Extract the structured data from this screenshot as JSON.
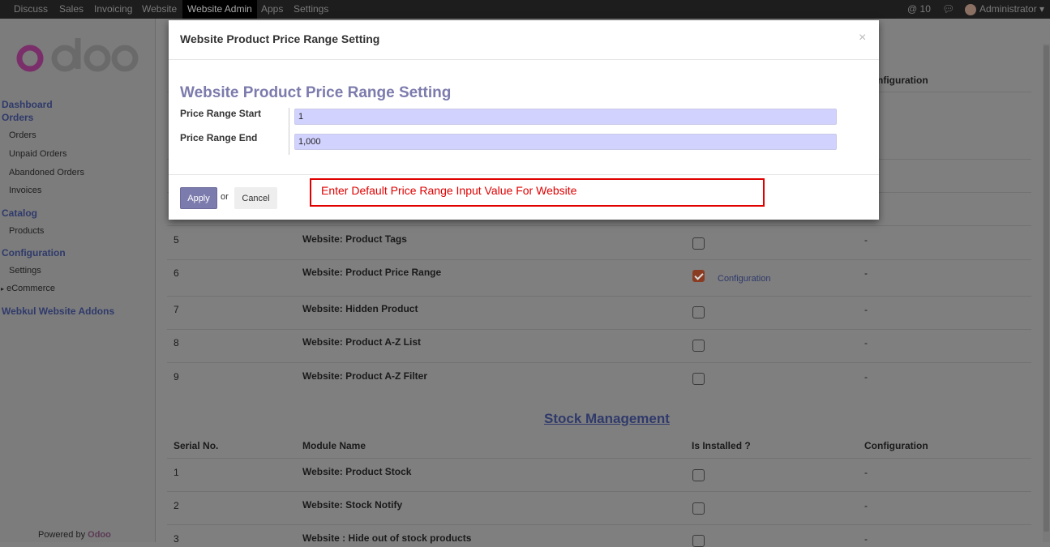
{
  "topbar": {
    "menu": [
      "Discuss",
      "Sales",
      "Invoicing",
      "Website",
      "Website Admin",
      "Apps",
      "Settings"
    ],
    "active_index": 4,
    "notifications": "10",
    "user": "Administrator"
  },
  "sidebar": {
    "logo_text": "odoo",
    "sections": [
      {
        "label": "Dashboard"
      },
      {
        "label": "Orders",
        "items": [
          "Orders",
          "Unpaid Orders",
          "Abandoned Orders",
          "Invoices"
        ]
      },
      {
        "label": "Catalog",
        "items": [
          "Products"
        ]
      },
      {
        "label": "Configuration",
        "items": [
          "Settings",
          "eCommerce"
        ]
      },
      {
        "label": "Webkul Website Addons"
      }
    ],
    "powered_prefix": "Powered by",
    "powered_brand": "Odoo"
  },
  "table_a": {
    "partial_header": "Configuration",
    "rows": [
      {
        "serial": "5",
        "module": "Website: Product Tags",
        "installed": false,
        "config": "-"
      },
      {
        "serial": "6",
        "module": "Website: Product Price Range",
        "installed": true,
        "config_link": "Configuration",
        "config": "-"
      },
      {
        "serial": "7",
        "module": "Website: Hidden Product",
        "installed": false,
        "config": "-"
      },
      {
        "serial": "8",
        "module": "Website: Product A-Z List",
        "installed": false,
        "config": "-"
      },
      {
        "serial": "9",
        "module": "Website: Product A-Z Filter",
        "installed": false,
        "config": "-"
      }
    ]
  },
  "stock": {
    "title": "Stock Management",
    "headers": [
      "Serial No.",
      "Module Name",
      "Is Installed ?",
      "Configuration"
    ],
    "rows": [
      {
        "serial": "1",
        "module": "Website: Product Stock",
        "installed": false,
        "config": "-"
      },
      {
        "serial": "2",
        "module": "Website: Stock Notify",
        "installed": false,
        "config": "-"
      },
      {
        "serial": "3",
        "module": "Website : Hide out of stock products",
        "installed": false,
        "config": "-"
      }
    ]
  },
  "modal": {
    "title": "Website Product Price Range Setting",
    "close": "×",
    "form_title": "Website Product Price Range Setting",
    "fields": [
      {
        "label": "Price Range Start",
        "value": "1"
      },
      {
        "label": "Price Range End",
        "value": "1,000"
      }
    ],
    "apply": "Apply",
    "or": "or",
    "cancel": "Cancel",
    "annotation": "Enter Default Price Range Input Value For Website"
  },
  "colors": {
    "accent": "#7c7bad",
    "annotation": "#e00000",
    "checked": "#8a3c22"
  }
}
